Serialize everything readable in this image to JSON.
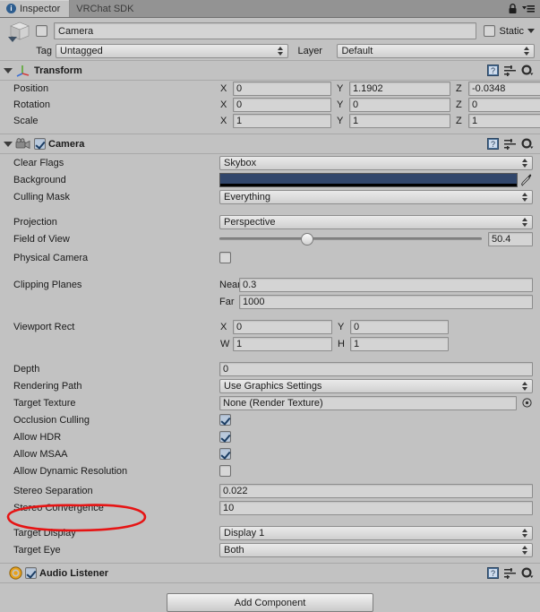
{
  "window": {
    "tabs": [
      {
        "label": "Inspector",
        "icon": "info-icon",
        "active": true
      },
      {
        "label": "VRChat SDK",
        "icon": "",
        "active": false
      }
    ],
    "lock_icon": "lock-icon",
    "menu_icon": "hamburger-menu-icon"
  },
  "header": {
    "gameobject_icon": "cube-icon",
    "enabled_checked": false,
    "name_value": "Camera",
    "static_label": "Static",
    "static_checked": false,
    "static_dropdown_icon": "chevron-down-icon",
    "tag_label": "Tag",
    "tag_value": "Untagged",
    "layer_label": "Layer",
    "layer_value": "Default"
  },
  "components": [
    {
      "name": "Transform",
      "icon": "transform-axis-icon",
      "has_checkbox": false,
      "header_icons": [
        "help-book-icon",
        "preset-icon",
        "gear-icon"
      ],
      "rows": [
        {
          "type": "vector3",
          "label": "Position",
          "axes": [
            "X",
            "Y",
            "Z"
          ],
          "values": [
            "0",
            "1.1902",
            "-0.0348"
          ]
        },
        {
          "type": "vector3",
          "label": "Rotation",
          "axes": [
            "X",
            "Y",
            "Z"
          ],
          "values": [
            "0",
            "0",
            "0"
          ]
        },
        {
          "type": "vector3",
          "label": "Scale",
          "axes": [
            "X",
            "Y",
            "Z"
          ],
          "values": [
            "1",
            "1",
            "1"
          ]
        }
      ]
    },
    {
      "name": "Camera",
      "icon": "camera-icon",
      "has_checkbox": true,
      "checked": true,
      "header_icons": [
        "help-book-icon",
        "preset-icon",
        "gear-icon"
      ],
      "rows": [
        {
          "type": "popup",
          "label": "Clear Flags",
          "value": "Skybox"
        },
        {
          "type": "color",
          "label": "Background",
          "color": "#31466b",
          "alpha_color": "#000000",
          "eyedropper_icon": "eyedropper-icon"
        },
        {
          "type": "popup",
          "label": "Culling Mask",
          "value": "Everything"
        },
        {
          "type": "spacer"
        },
        {
          "type": "popup",
          "label": "Projection",
          "value": "Perspective"
        },
        {
          "type": "slider",
          "label": "Field of View",
          "value": "50.4",
          "min": 1,
          "max": 179,
          "percent": 33
        },
        {
          "type": "checkbox",
          "label": "Physical Camera",
          "checked": false
        },
        {
          "type": "spacer"
        },
        {
          "type": "pair2",
          "label": "Clipping Planes",
          "sub_labels": [
            "Near",
            "Far"
          ],
          "values": [
            "0.3",
            "1000"
          ]
        },
        {
          "type": "spacer"
        },
        {
          "type": "rect",
          "label": "Viewport Rect",
          "sub_labels": [
            "X",
            "Y",
            "W",
            "H"
          ],
          "values": [
            "0",
            "0",
            "1",
            "1"
          ]
        },
        {
          "type": "spacer"
        },
        {
          "type": "text",
          "label": "Depth",
          "value": "0"
        },
        {
          "type": "popup",
          "label": "Rendering Path",
          "value": "Use Graphics Settings"
        },
        {
          "type": "object",
          "label": "Target Texture",
          "value": "None (Render Texture)",
          "picker_icon": "object-picker-icon"
        },
        {
          "type": "checkbox",
          "label": "Occlusion Culling",
          "checked": true
        },
        {
          "type": "checkbox",
          "label": "Allow HDR",
          "checked": true
        },
        {
          "type": "checkbox",
          "label": "Allow MSAA",
          "checked": true
        },
        {
          "type": "checkbox",
          "label": "Allow Dynamic Resolution",
          "checked": false
        },
        {
          "type": "text",
          "label": "Stereo Separation",
          "value": "0.022"
        },
        {
          "type": "text",
          "label": "Stereo Convergence",
          "value": "10"
        },
        {
          "type": "spacer"
        },
        {
          "type": "popup",
          "label": "Target Display",
          "value": "Display 1"
        },
        {
          "type": "popup",
          "label": "Target Eye",
          "value": "Both"
        }
      ]
    },
    {
      "name": "Audio Listener",
      "icon": "audio-listener-icon",
      "has_checkbox": true,
      "checked": true,
      "header_icons": [
        "help-book-icon",
        "preset-icon",
        "gear-icon"
      ],
      "rows": []
    }
  ],
  "footer": {
    "add_component_label": "Add Component"
  },
  "annotation": {
    "shape": "ellipse",
    "color": "#e61414",
    "target": "Audio Listener component header"
  },
  "colors": {
    "panel_bg": "#c2c2c2",
    "tabbar_bg": "#939393",
    "field_bg": "#d4d4d4",
    "accent": "#31466b",
    "annotation_red": "#e61414"
  }
}
